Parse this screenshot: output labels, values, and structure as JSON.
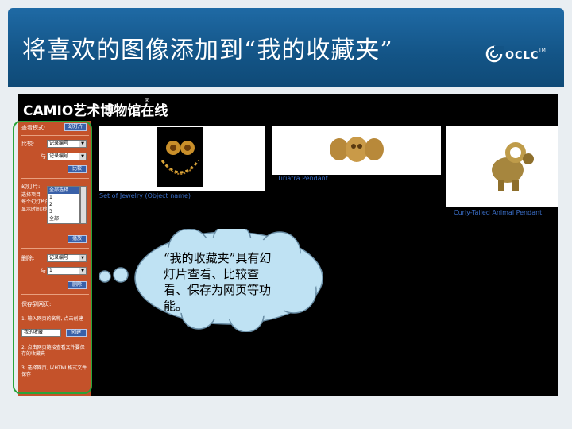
{
  "slide": {
    "title": "将喜欢的图像添加到“我的收藏夹”",
    "logo_text": "OCLC",
    "logo_tm": "TM"
  },
  "app": {
    "title": "CAMIO艺术博物馆在线",
    "registered_mark": "®"
  },
  "sidebar": {
    "view_mode_label": "查看模式:",
    "view_mode_button": "幻灯片",
    "compare_label": "比较:",
    "compare_select": "记录编号",
    "with_label": "与",
    "with_select": "记录编号",
    "compare_button": "比较",
    "slideshow_label": "幻灯片:",
    "slideshow_desc": [
      "选择项目",
      "每个幻灯片的",
      "显示时间(秒)"
    ],
    "slideshow_options": [
      "全部选择",
      "1",
      "2",
      "3",
      "全部"
    ],
    "slideshow_button": "播放",
    "delete_label": "删除:",
    "delete_select": "记录编号",
    "delete_with_label": "与",
    "delete_with_select": "1",
    "delete_button": "删除",
    "save_label": "保存到网页:",
    "save_step1": "1. 输入网页的名称, 点击创建",
    "save_input": "我的收藏",
    "save_button": "创建",
    "save_step2": "2. 点击网页链接查看文件要保存的收藏夹",
    "save_step3": "3. 选择网页, 以HTML格式文件保存"
  },
  "results": [
    {
      "caption": "Set of Jewelry (Object name)"
    },
    {
      "caption": "Tiriatra Pendant"
    },
    {
      "caption": "Curly-Tailed Animal Pendant"
    }
  ],
  "callout": {
    "text": "“我的收藏夹”具有幻灯片查看、比较查看、保存为网页等功能。"
  },
  "colors": {
    "header_blue": "#135486",
    "sidebar_orange": "#c4522a",
    "highlight_green": "#2aa33a",
    "link_blue": "#3b6fc9"
  }
}
